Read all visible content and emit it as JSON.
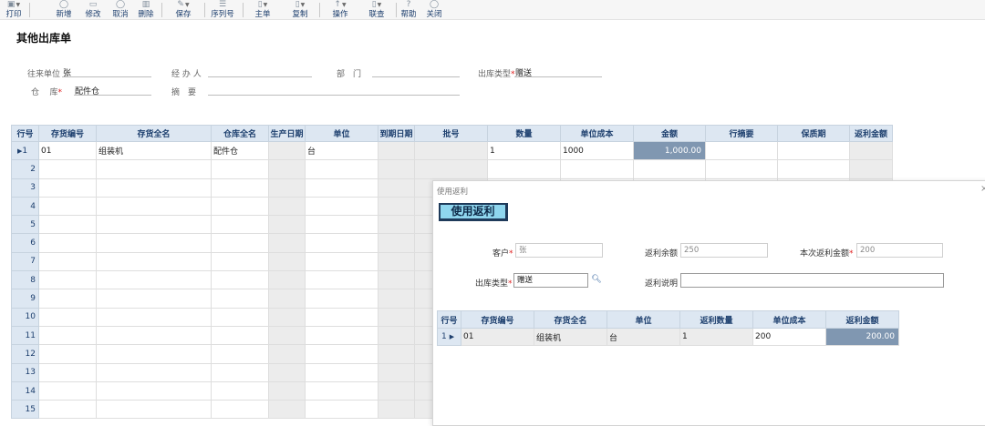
{
  "toolbar": {
    "print": "打印",
    "new": "新增",
    "edit": "修改",
    "cancel": "取消",
    "delete": "删除",
    "save": "保存",
    "serial": "序列号",
    "master": "主单",
    "copy": "复制",
    "operate": "操作",
    "query": "联查",
    "help": "帮助",
    "close": "关闭"
  },
  "document": {
    "title": "其他出库单"
  },
  "header": {
    "partner_label": "往来单位",
    "partner_value": "张",
    "handler_label": "经 办 人",
    "handler_value": "",
    "dept_label": "部　门",
    "dept_value": "",
    "outtype_label": "出库类型",
    "outtype_value": "赠送",
    "warehouse_label_a": "仓",
    "warehouse_label_b": "库",
    "warehouse_value": "配件仓",
    "summary_label": "摘　要",
    "summary_value": ""
  },
  "grid": {
    "columns": [
      "行号",
      "存货编号",
      "存货全名",
      "仓库全名",
      "生产日期",
      "单位",
      "到期日期",
      "批号",
      "数量",
      "单位成本",
      "金额",
      "行摘要",
      "保质期",
      "返利金额"
    ],
    "rows": [
      {
        "no": "1",
        "code": "01",
        "name": "组装机",
        "warehouse": "配件仓",
        "prod_date": "",
        "unit": "台",
        "expiry": "",
        "batch": "",
        "qty": "1",
        "unit_cost": "1000",
        "amount": "1,000.00",
        "memo": "",
        "shelf": "",
        "rebate": ""
      },
      {
        "no": "2"
      },
      {
        "no": "3"
      },
      {
        "no": "4"
      },
      {
        "no": "5"
      },
      {
        "no": "6"
      },
      {
        "no": "7"
      },
      {
        "no": "8"
      },
      {
        "no": "9"
      },
      {
        "no": "10"
      },
      {
        "no": "11"
      },
      {
        "no": "12"
      },
      {
        "no": "13"
      },
      {
        "no": "14"
      },
      {
        "no": "15"
      }
    ]
  },
  "dialog": {
    "caption": "使用返利",
    "close_symbol": "×",
    "heading": "使用返利",
    "customer_label": "客户",
    "customer_value": "张",
    "rebate_balance_label": "返利余额",
    "rebate_balance_value": "250",
    "this_rebate_label": "本次返利金额",
    "this_rebate_value": "200",
    "outtype_label": "出库类型",
    "outtype_value": "赠送",
    "rebate_note_label": "返利说明",
    "rebate_note_value": "",
    "grid": {
      "columns": [
        "行号",
        "存货编号",
        "存货全名",
        "单位",
        "返利数量",
        "单位成本",
        "返利金额"
      ],
      "rows": [
        {
          "no": "1",
          "code": "01",
          "name": "组装机",
          "unit": "台",
          "qty": "1",
          "unit_cost": "200",
          "amount": "200.00"
        }
      ]
    }
  },
  "colors": {
    "header_bg": "#dde7f2",
    "header_text": "#1d3f6e",
    "selected_amount_bg": "#8097b1",
    "required_star": "#e02020",
    "dialog_heading_bg": "#8fd6ee"
  }
}
